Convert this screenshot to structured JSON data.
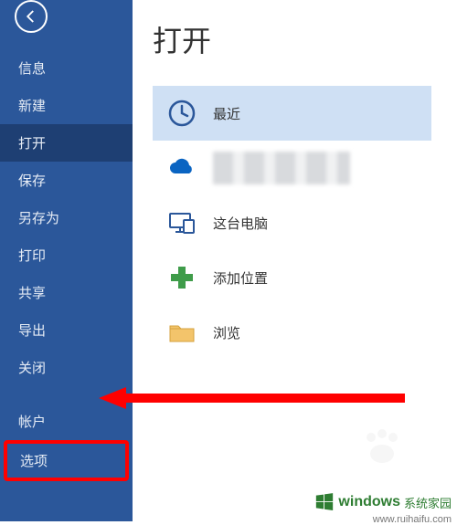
{
  "sidebar": {
    "items": [
      {
        "label": "信息"
      },
      {
        "label": "新建"
      },
      {
        "label": "打开"
      },
      {
        "label": "保存"
      },
      {
        "label": "另存为"
      },
      {
        "label": "打印"
      },
      {
        "label": "共享"
      },
      {
        "label": "导出"
      },
      {
        "label": "关闭"
      }
    ],
    "account_label": "帐户",
    "options_label": "选项"
  },
  "main": {
    "title": "打开",
    "locations": {
      "recent": "最近",
      "this_pc": "这台电脑",
      "add_place": "添加位置",
      "browse": "浏览"
    }
  },
  "watermark": {
    "brand1": "windows",
    "brand2": "系统家园",
    "url": "www.ruihaifu.com"
  }
}
